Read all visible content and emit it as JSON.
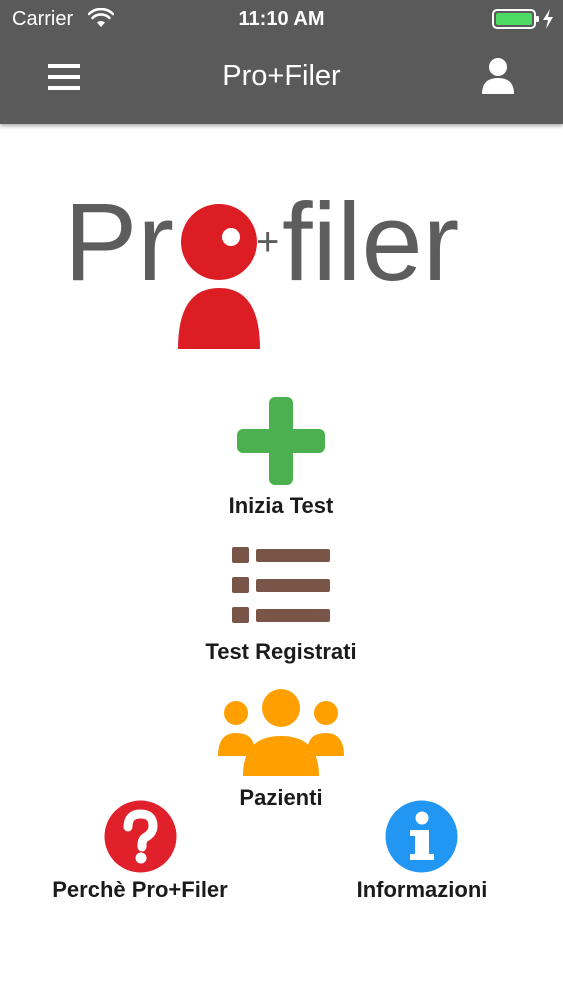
{
  "status_bar": {
    "carrier": "Carrier",
    "time": "11:10 AM",
    "wifi_icon": "wifi-icon",
    "battery_icon": "battery-icon",
    "battery_color": "#4cd964"
  },
  "nav_bar": {
    "title": "Pro+Filer",
    "menu_icon": "hamburger-menu-icon",
    "profile_icon": "user-profile-icon",
    "background": "#5a5a5a"
  },
  "logo": {
    "text_left": "Pr",
    "text_right": "filer",
    "plus": "+",
    "red": "#dc1e24",
    "gray": "#5d5d5d"
  },
  "actions": {
    "start_test": {
      "label": "Inizia Test",
      "icon": "plus-icon",
      "color": "#4caf50"
    },
    "saved_tests": {
      "label": "Test Registrati",
      "icon": "list-icon",
      "color": "#795548"
    },
    "patients": {
      "label": "Pazienti",
      "icon": "group-icon",
      "color": "#ff9f00"
    },
    "why": {
      "label": "Perchè Pro+Filer",
      "icon": "question-icon",
      "color": "#e0202a"
    },
    "info": {
      "label": "Informazioni",
      "icon": "info-icon",
      "color": "#2196f3"
    }
  }
}
